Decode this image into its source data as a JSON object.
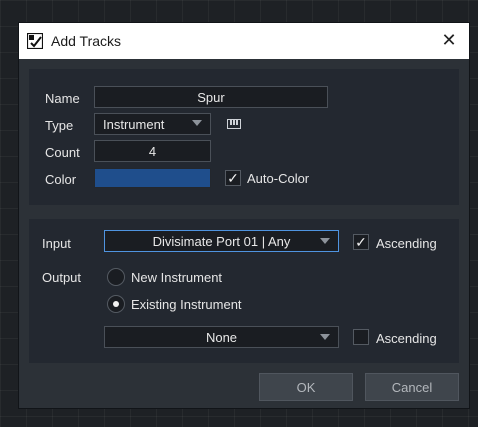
{
  "dialog": {
    "title": "Add Tracks",
    "close_glyph": "✕",
    "title_icon": "add-tracks-icon"
  },
  "top": {
    "name_label": "Name",
    "name_value": "Spur",
    "type_label": "Type",
    "type_value": "Instrument",
    "type_icon": "piano-keys-icon",
    "count_label": "Count",
    "count_value": "4",
    "color_label": "Color",
    "color_value": "#1f4e8c",
    "auto_color_label": "Auto-Color",
    "auto_color_checked": true
  },
  "bottom": {
    "input_label": "Input",
    "input_value": "Divisimate Port 01 | Any",
    "input_ascending_label": "Ascending",
    "input_ascending_checked": true,
    "output_label": "Output",
    "new_instrument_label": "New Instrument",
    "existing_instrument_label": "Existing Instrument",
    "selected_output": "Existing Instrument",
    "instrument_value": "None",
    "output_ascending_label": "Ascending",
    "output_ascending_checked": false
  },
  "buttons": {
    "ok_label": "OK",
    "cancel_label": "Cancel"
  },
  "colors": {
    "focus_accent": "#4f94e0",
    "dialog_bg": "#2c3137",
    "panel_bg": "#232830"
  },
  "check_glyph": "✓"
}
